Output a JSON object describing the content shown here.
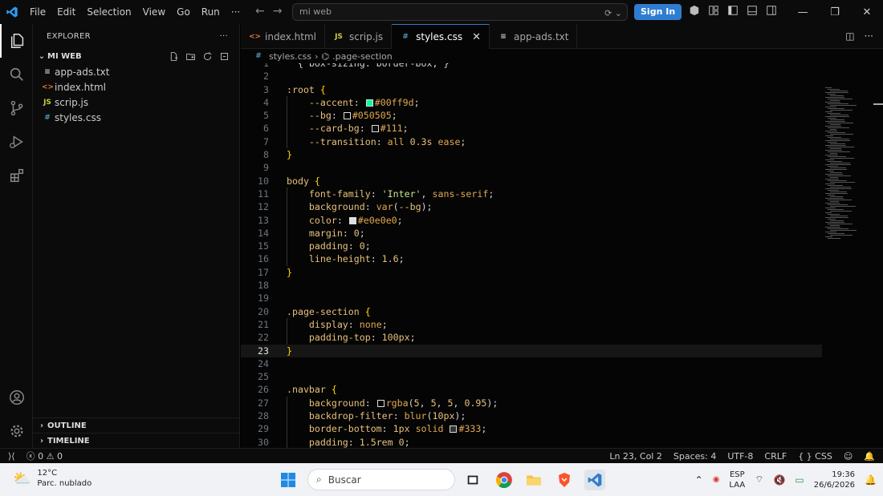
{
  "titlebar": {
    "menu": [
      "File",
      "Edit",
      "Selection",
      "View",
      "Go",
      "Run",
      "···"
    ],
    "search_text": "mi web",
    "signin_label": "Sign In"
  },
  "explorer": {
    "title": "EXPLORER",
    "more": "···",
    "folder": "MI WEB",
    "files": [
      {
        "name": "app-ads.txt",
        "icon": "text-file-icon",
        "glyph": "≡",
        "color": "#cccccc"
      },
      {
        "name": "index.html",
        "icon": "html-file-icon",
        "glyph": "<>",
        "color": "#e37933"
      },
      {
        "name": "scrip.js",
        "icon": "js-file-icon",
        "glyph": "JS",
        "color": "#cbcb41"
      },
      {
        "name": "styles.css",
        "icon": "css-file-icon",
        "glyph": "#",
        "color": "#519aba"
      }
    ],
    "outline_label": "OUTLINE",
    "timeline_label": "TIMELINE"
  },
  "tabs": [
    {
      "label": "index.html",
      "glyph": "<>",
      "color": "#e37933",
      "active": false
    },
    {
      "label": "scrip.js",
      "glyph": "JS",
      "color": "#cbcb41",
      "active": false
    },
    {
      "label": "styles.css",
      "glyph": "#",
      "color": "#519aba",
      "active": true
    },
    {
      "label": "app-ads.txt",
      "glyph": "≡",
      "color": "#cccccc",
      "active": false
    }
  ],
  "breadcrumb": {
    "file": "styles.css",
    "symbol": ".page-section"
  },
  "code": {
    "current_line": 23,
    "lines": [
      {
        "n": "1",
        "html": "<span class='punc'>  { box-sizing: border-box; }</span>"
      },
      {
        "n": "2",
        "html": ""
      },
      {
        "n": "3",
        "html": "<span class='sel'>:root</span> <span class='brace'>{</span>"
      },
      {
        "n": "4",
        "html": "    <span class='prop'>--accent</span><span class='punc'>: </span><span class='swatch' style='background:#00ff9d'></span><span class='val'>#00ff9d</span><span class='punc'>;</span>"
      },
      {
        "n": "5",
        "html": "    <span class='prop'>--bg</span><span class='punc'>: </span><span class='swatch' style='background:#050505'></span><span class='val'>#050505</span><span class='punc'>;</span>"
      },
      {
        "n": "6",
        "html": "    <span class='prop'>--card-bg</span><span class='punc'>: </span><span class='swatch' style='background:#111111'></span><span class='val'>#111</span><span class='punc'>;</span>"
      },
      {
        "n": "7",
        "html": "    <span class='prop'>--transition</span><span class='punc'>: </span><span class='val'>all</span> <span class='num'>0.3s</span> <span class='val'>ease</span><span class='punc'>;</span>"
      },
      {
        "n": "8",
        "html": "<span class='brace'>}</span>"
      },
      {
        "n": "9",
        "html": ""
      },
      {
        "n": "10",
        "html": "<span class='sel'>body</span> <span class='brace'>{</span>"
      },
      {
        "n": "11",
        "html": "    <span class='prop'>font-family</span><span class='punc'>: </span><span class='str'>'Inter'</span><span class='punc'>, </span><span class='val'>sans-serif</span><span class='punc'>;</span>"
      },
      {
        "n": "12",
        "html": "    <span class='prop'>background</span><span class='punc'>: </span><span class='val'>var</span><span class='punc'>(</span><span class='prop'>--bg</span><span class='punc'>);</span>"
      },
      {
        "n": "13",
        "html": "    <span class='prop'>color</span><span class='punc'>: </span><span class='swatch' style='background:#e0e0e0'></span><span class='val'>#e0e0e0</span><span class='punc'>;</span>"
      },
      {
        "n": "14",
        "html": "    <span class='prop'>margin</span><span class='punc'>: </span><span class='num'>0</span><span class='punc'>;</span>"
      },
      {
        "n": "15",
        "html": "    <span class='prop'>padding</span><span class='punc'>: </span><span class='num'>0</span><span class='punc'>;</span>"
      },
      {
        "n": "16",
        "html": "    <span class='prop'>line-height</span><span class='punc'>: </span><span class='num'>1.6</span><span class='punc'>;</span>"
      },
      {
        "n": "17",
        "html": "<span class='brace'>}</span>"
      },
      {
        "n": "18",
        "html": ""
      },
      {
        "n": "19",
        "html": ""
      },
      {
        "n": "20",
        "html": "<span class='sel'>.page-section</span> <span class='brace'>{</span>"
      },
      {
        "n": "21",
        "html": "    <span class='prop'>display</span><span class='punc'>: </span><span class='val'>none</span><span class='punc'>;</span>"
      },
      {
        "n": "22",
        "html": "    <span class='prop'>padding-top</span><span class='punc'>: </span><span class='num'>100px</span><span class='punc'>;</span>"
      },
      {
        "n": "23",
        "html": "<span class='brace'>}</span>"
      },
      {
        "n": "24",
        "html": ""
      },
      {
        "n": "25",
        "html": ""
      },
      {
        "n": "26",
        "html": "<span class='sel'>.navbar</span> <span class='brace'>{</span>"
      },
      {
        "n": "27",
        "html": "    <span class='prop'>background</span><span class='punc'>: </span><span class='swatch' style='background:#050505'></span><span class='val'>rgba</span><span class='punc'>(</span><span class='num'>5</span><span class='punc'>, </span><span class='num'>5</span><span class='punc'>, </span><span class='num'>5</span><span class='punc'>, </span><span class='num'>0.95</span><span class='punc'>);</span>"
      },
      {
        "n": "28",
        "html": "    <span class='prop'>backdrop-filter</span><span class='punc'>: </span><span class='val'>blur</span><span class='punc'>(</span><span class='num'>10px</span><span class='punc'>);</span>"
      },
      {
        "n": "29",
        "html": "    <span class='prop'>border-bottom</span><span class='punc'>: </span><span class='num'>1px</span> <span class='val'>solid</span> <span class='swatch' style='background:#333333'></span><span class='val'>#333</span><span class='punc'>;</span>"
      },
      {
        "n": "30",
        "html": "    <span class='prop'>padding</span><span class='punc'>: </span><span class='num'>1.5rem</span> <span class='num'>0</span><span class='punc'>;</span>"
      }
    ]
  },
  "statusbar": {
    "errors": "0",
    "warnings": "0",
    "position": "Ln 23, Col 2",
    "spaces": "Spaces: 4",
    "encoding": "UTF-8",
    "eol": "CRLF",
    "language": "{ } CSS"
  },
  "taskbar": {
    "temp": "12°C",
    "weather": "Parc. nublado",
    "search": "Buscar",
    "lang1": "ESP",
    "lang2": "LAA",
    "time": "19:36",
    "date": "26/6/2026"
  },
  "colors": {
    "accent": "#2f7dd1",
    "editor_bg": "#050505",
    "panel_bg": "#0b0b0b"
  }
}
